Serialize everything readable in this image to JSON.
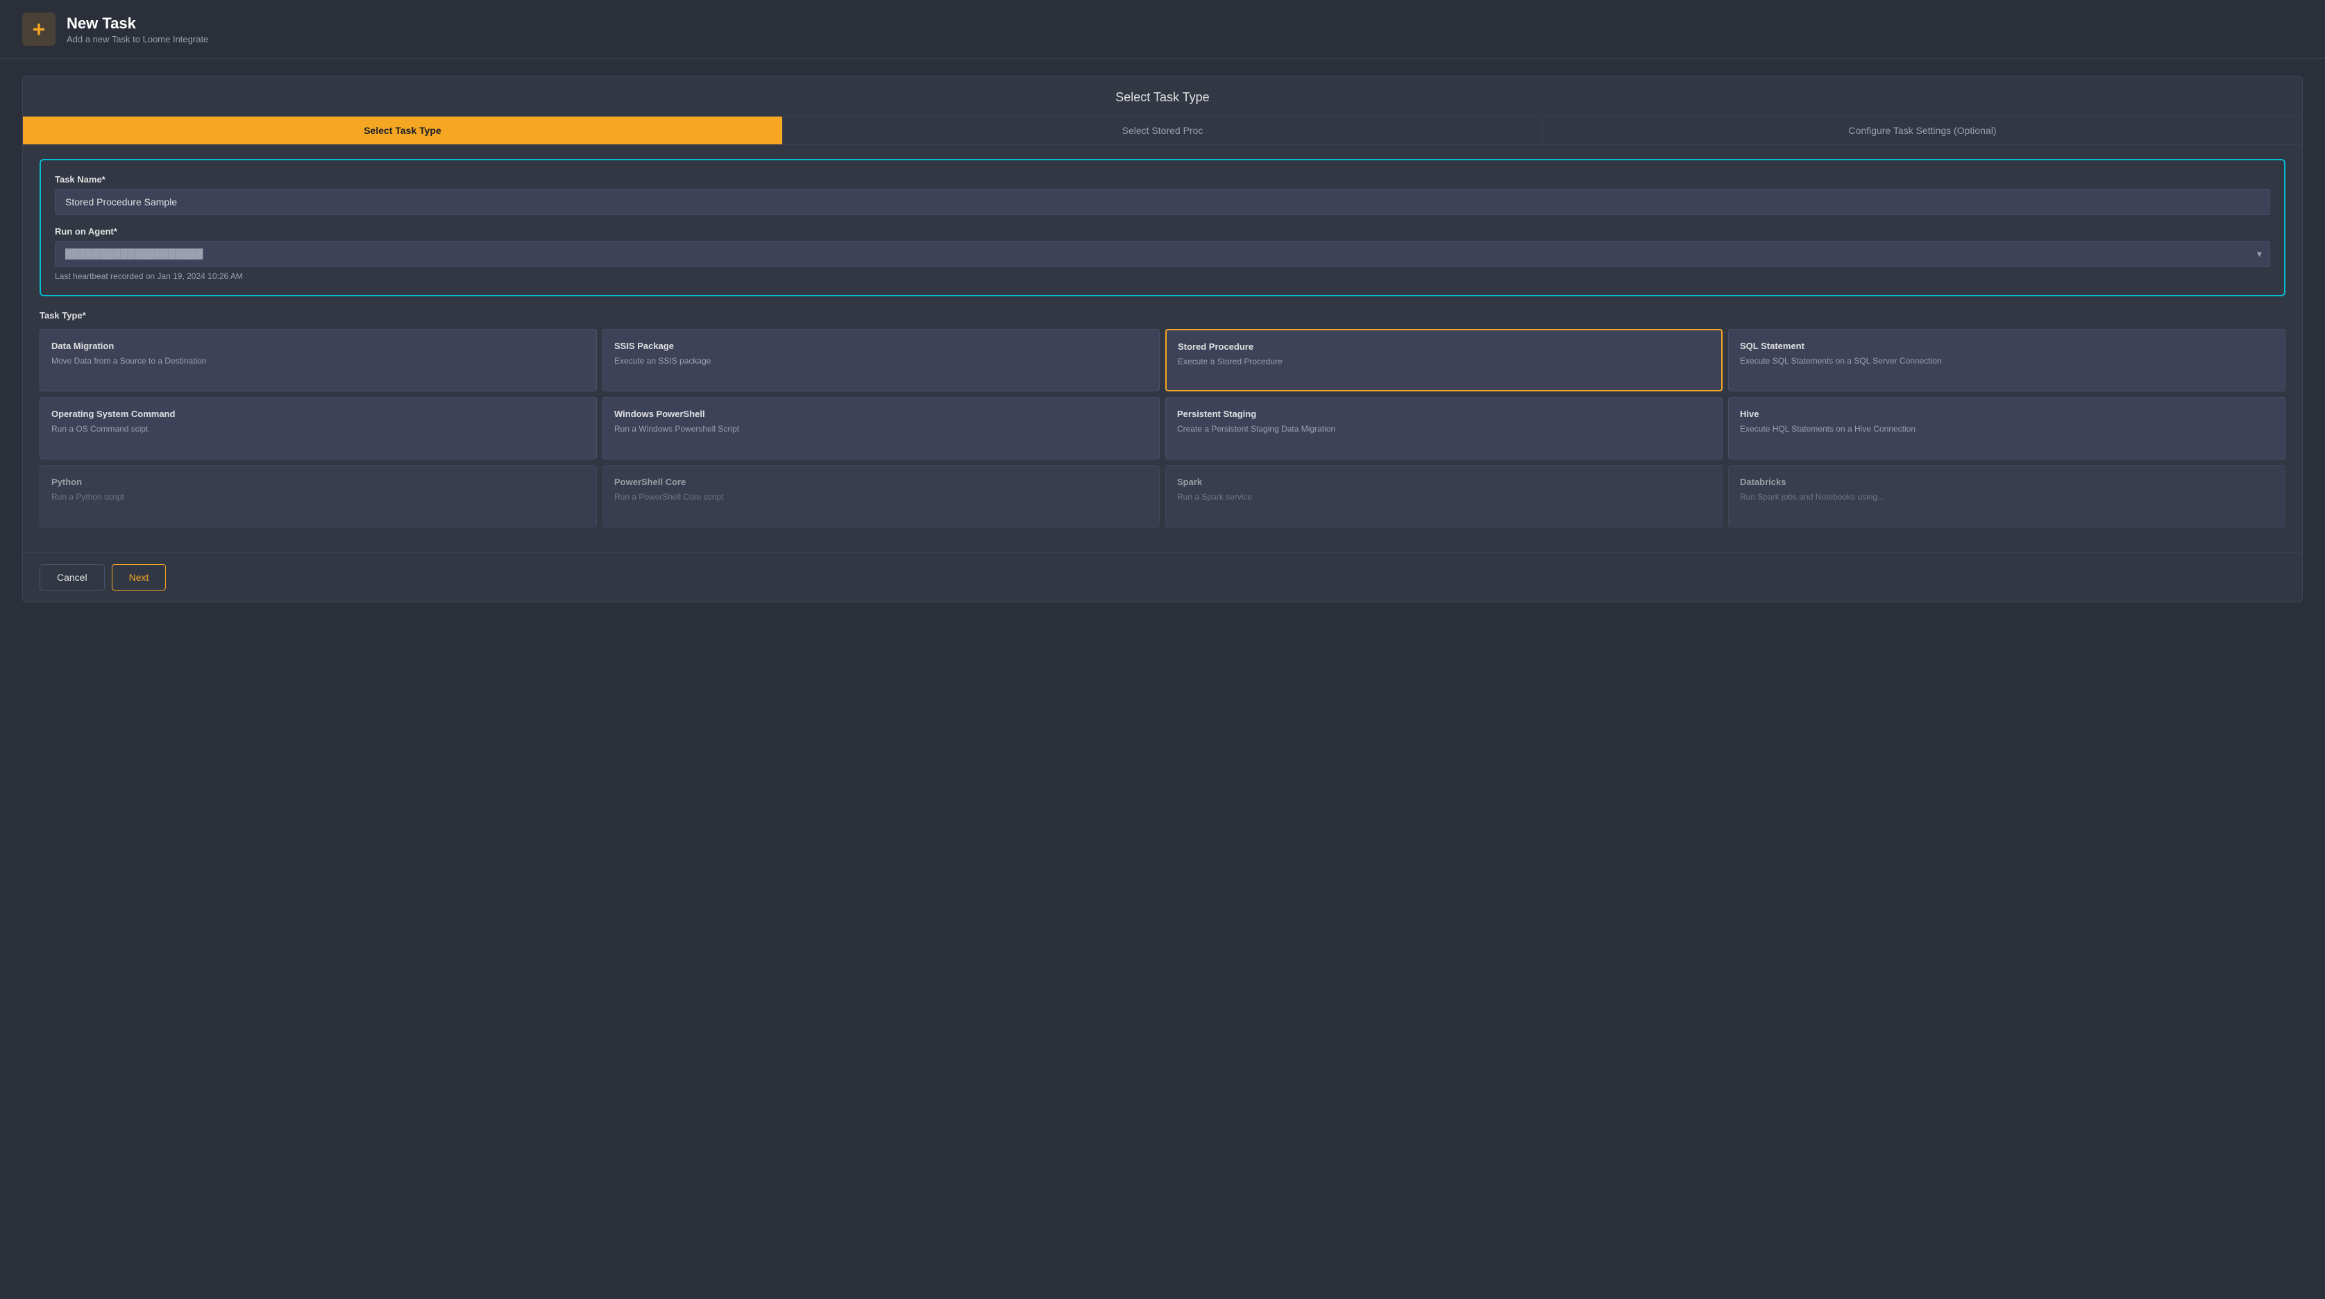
{
  "header": {
    "title": "New Task",
    "subtitle": "Add a new Task to Loome Integrate",
    "plus_icon": "+"
  },
  "wizard": {
    "title": "Select Task Type",
    "steps": [
      {
        "id": "step-select-task-type",
        "label": "Select Task Type",
        "active": true
      },
      {
        "id": "step-select-stored-proc",
        "label": "Select Stored Proc",
        "active": false
      },
      {
        "id": "step-configure-settings",
        "label": "Configure Task Settings (Optional)",
        "active": false
      }
    ],
    "form": {
      "task_name_label": "Task Name*",
      "task_name_value": "Stored Procedure Sample",
      "run_on_agent_label": "Run on Agent*",
      "agent_placeholder": "████████████████████",
      "heartbeat_text": "Last heartbeat recorded on Jan 19, 2024 10:26 AM",
      "task_type_label": "Task Type*"
    },
    "task_types": [
      {
        "id": "data-migration",
        "title": "Data Migration",
        "description": "Move Data from a Source to a Destination",
        "selected": false
      },
      {
        "id": "ssis-package",
        "title": "SSIS Package",
        "description": "Execute an SSIS package",
        "selected": false
      },
      {
        "id": "stored-procedure",
        "title": "Stored Procedure",
        "description": "Execute a Stored Procedure",
        "selected": true
      },
      {
        "id": "sql-statement",
        "title": "SQL Statement",
        "description": "Execute SQL Statements on a SQL Server Connection",
        "selected": false
      },
      {
        "id": "operating-system-command",
        "title": "Operating System Command",
        "description": "Run a OS Command scipt",
        "selected": false
      },
      {
        "id": "windows-powershell",
        "title": "Windows PowerShell",
        "description": "Run a Windows Powershell Script",
        "selected": false
      },
      {
        "id": "persistent-staging",
        "title": "Persistent Staging",
        "description": "Create a Persistent Staging Data Migration",
        "selected": false
      },
      {
        "id": "hive",
        "title": "Hive",
        "description": "Execute HQL Statements on a Hive Connection",
        "selected": false
      },
      {
        "id": "python",
        "title": "Python",
        "description": "Run a Python script",
        "selected": false,
        "faded": true
      },
      {
        "id": "powershell-core",
        "title": "PowerShell Core",
        "description": "Run a PowerShell Core script",
        "selected": false,
        "faded": true
      },
      {
        "id": "spark",
        "title": "Spark",
        "description": "Run a Spark service",
        "selected": false,
        "faded": true
      },
      {
        "id": "databricks",
        "title": "Databricks",
        "description": "Run Spark jobs and Notebooks using...",
        "selected": false,
        "faded": true
      }
    ],
    "footer": {
      "cancel_label": "Cancel",
      "next_label": "Next"
    }
  }
}
